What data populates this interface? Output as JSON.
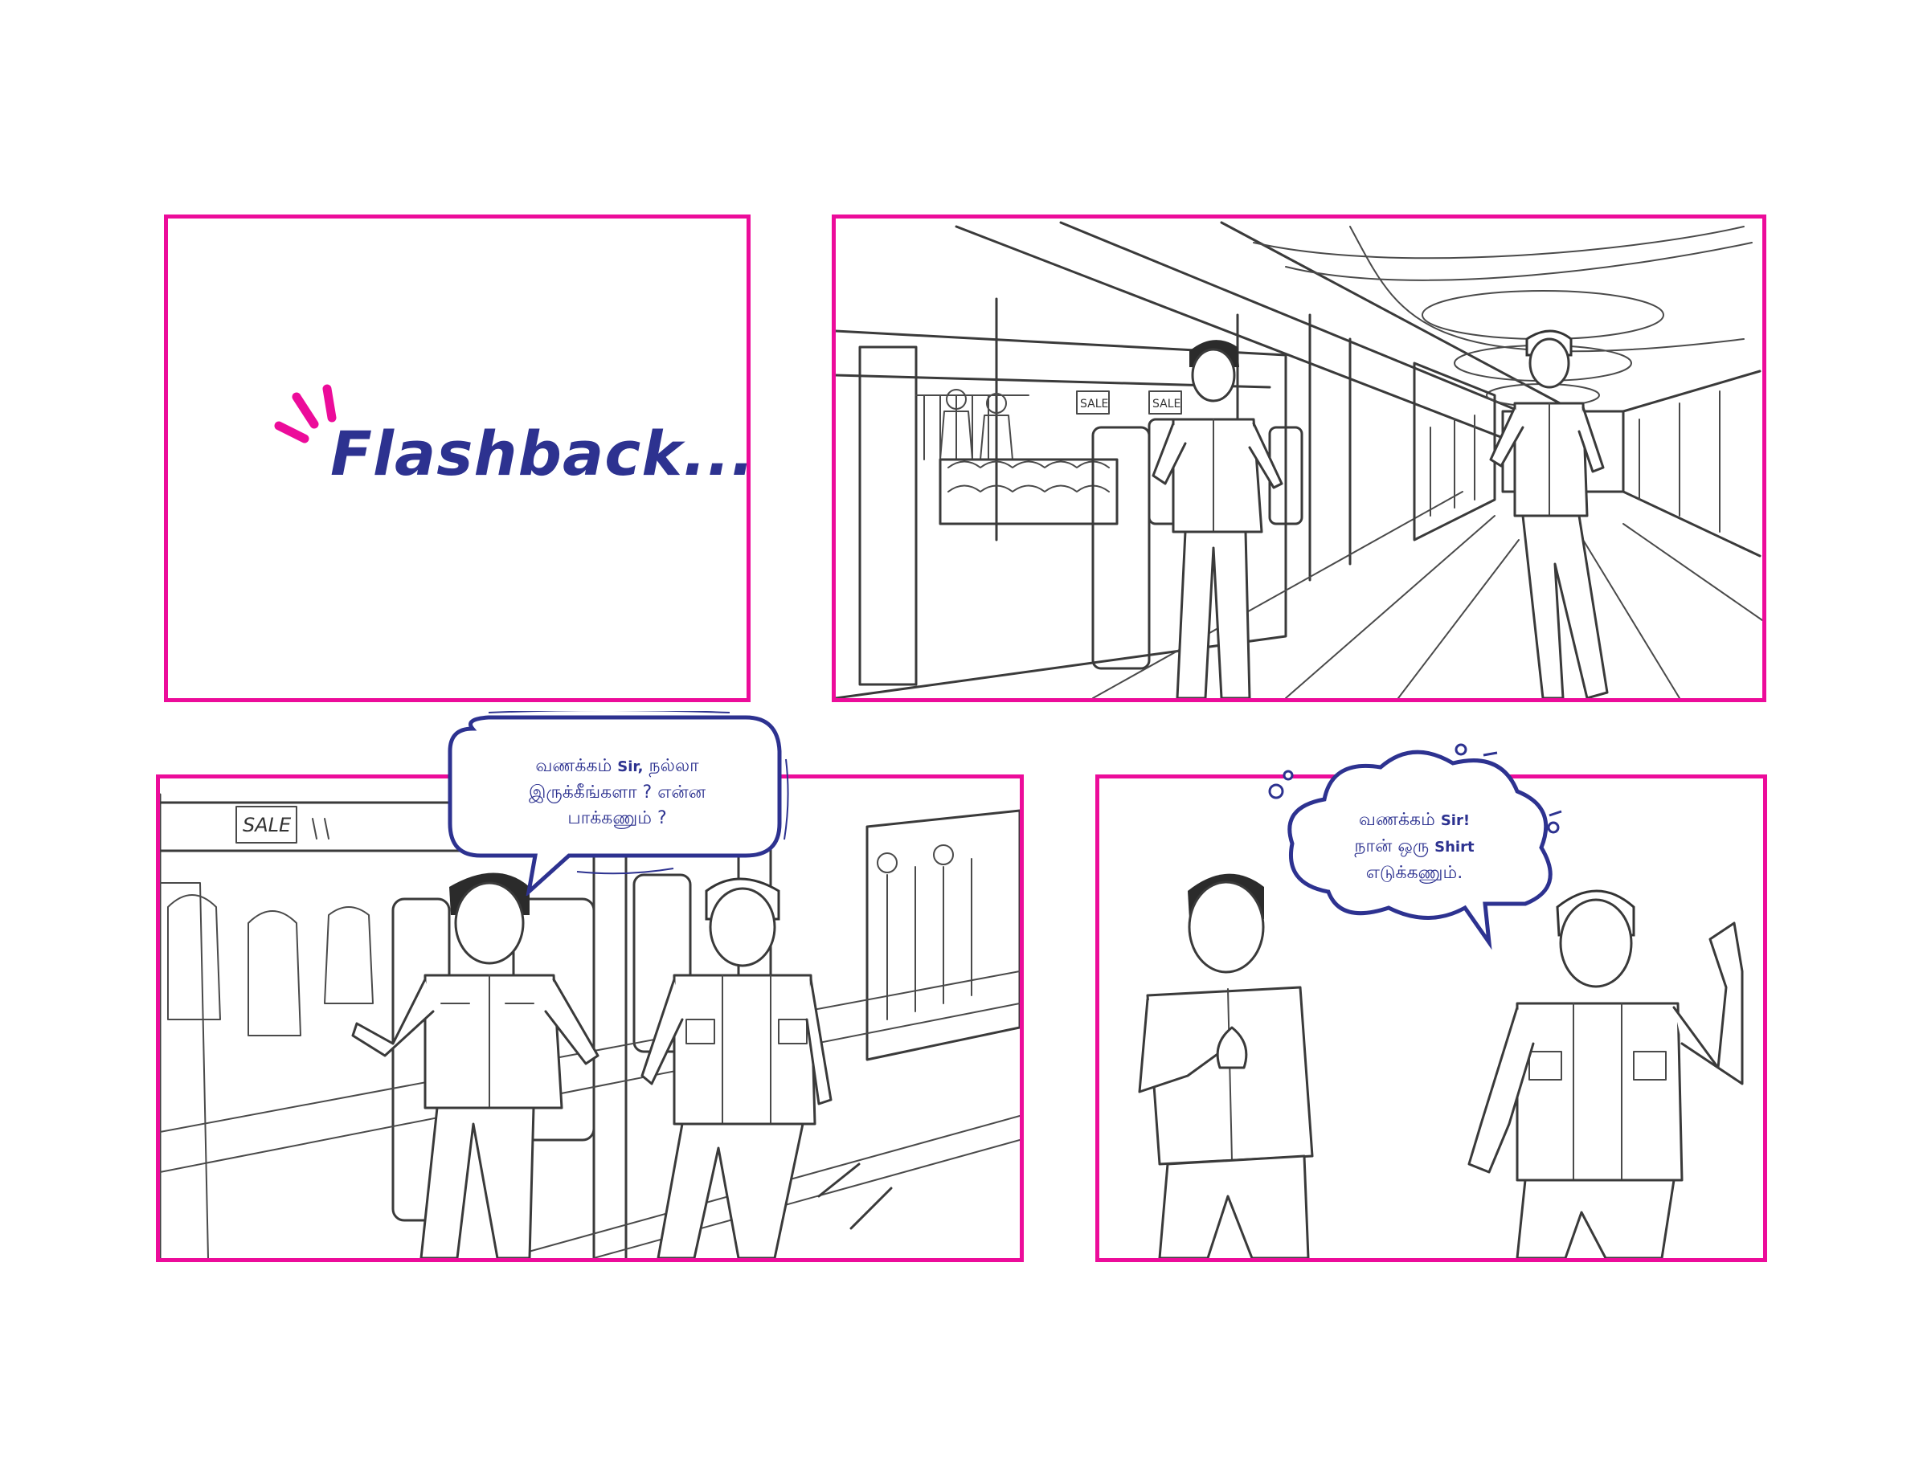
{
  "panel1": {
    "caption": "Flashback...."
  },
  "panel2": {
    "sale_sign_left": "SALE",
    "sale_sign_right": "SALE"
  },
  "panel3": {
    "sale_sign": "SALE",
    "bubble": {
      "line1_tamil": "வணக்கம்",
      "line1_latin": "Sir,",
      "line1_rest": "நல்லா",
      "line2": "இருக்கீங்களா ? என்ன",
      "line3": "பாக்கணும் ?"
    }
  },
  "panel4": {
    "bubble": {
      "line1_tamil": "வணக்கம்",
      "line1_latin": "Sir!",
      "line2_tamil": "நான் ஒரு",
      "line2_latin": "Shirt",
      "line3": "எடுக்கணும்."
    }
  },
  "colors": {
    "panel_border": "#ec0c9a",
    "text_ink": "#2d3290",
    "line_art": "#3a3a3a"
  }
}
